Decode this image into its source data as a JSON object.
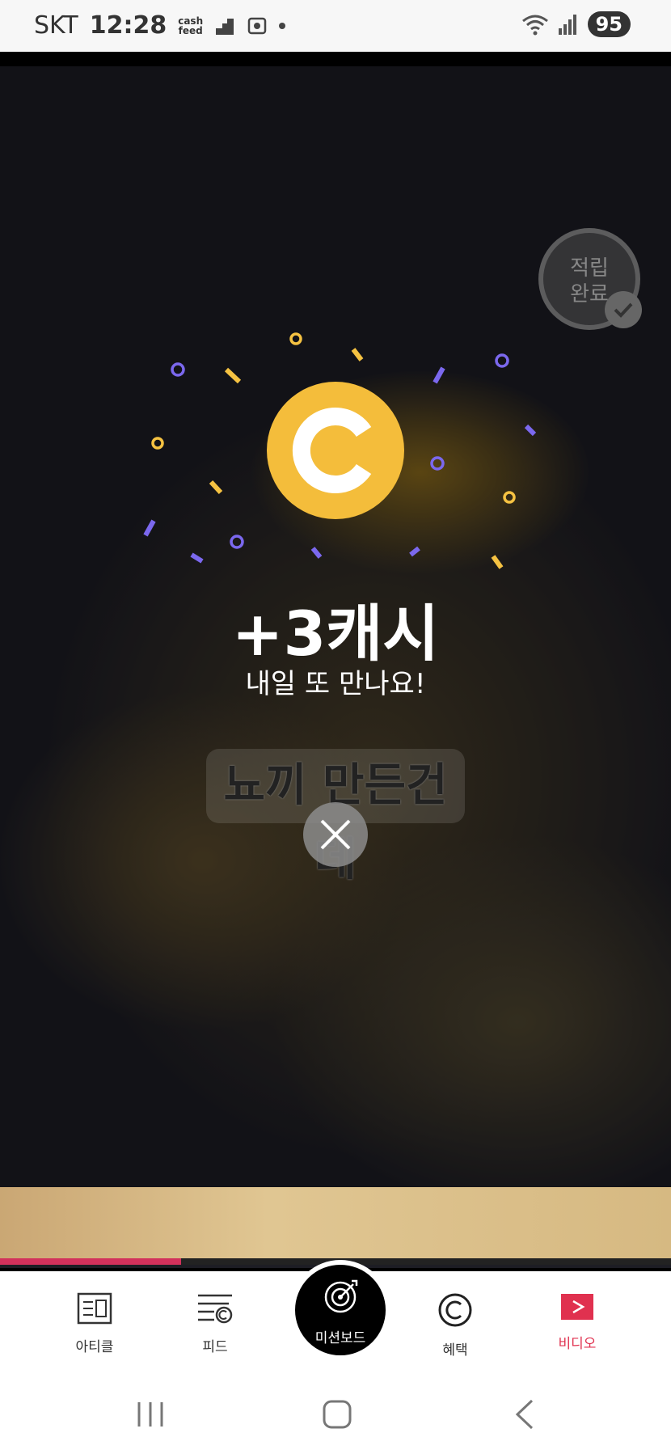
{
  "status_bar": {
    "carrier": "SKT",
    "time": "12:28",
    "cashfeed_line1": "cash",
    "cashfeed_line2": "feed",
    "battery": "95"
  },
  "badge": {
    "line1": "적립",
    "line2": "완료"
  },
  "reward": {
    "title": "+3캐시",
    "subtitle": "내일 또 만나요!"
  },
  "caption": "뇨끼 만든건데",
  "video": {
    "progress": 0.27
  },
  "bottom_nav": {
    "items": [
      {
        "label": "아티클",
        "icon": "article-icon"
      },
      {
        "label": "피드",
        "icon": "feed-icon"
      },
      {
        "label": "미션보드",
        "icon": "target-icon"
      },
      {
        "label": "혜택",
        "icon": "coin-c-icon"
      },
      {
        "label": "비디오",
        "icon": "play-icon"
      }
    ],
    "active": "비디오"
  },
  "colors": {
    "coin": "#f4bd3b",
    "accent": "#e0314f",
    "confetti_purple": "#7b68ee",
    "confetti_yellow": "#f5c242"
  }
}
